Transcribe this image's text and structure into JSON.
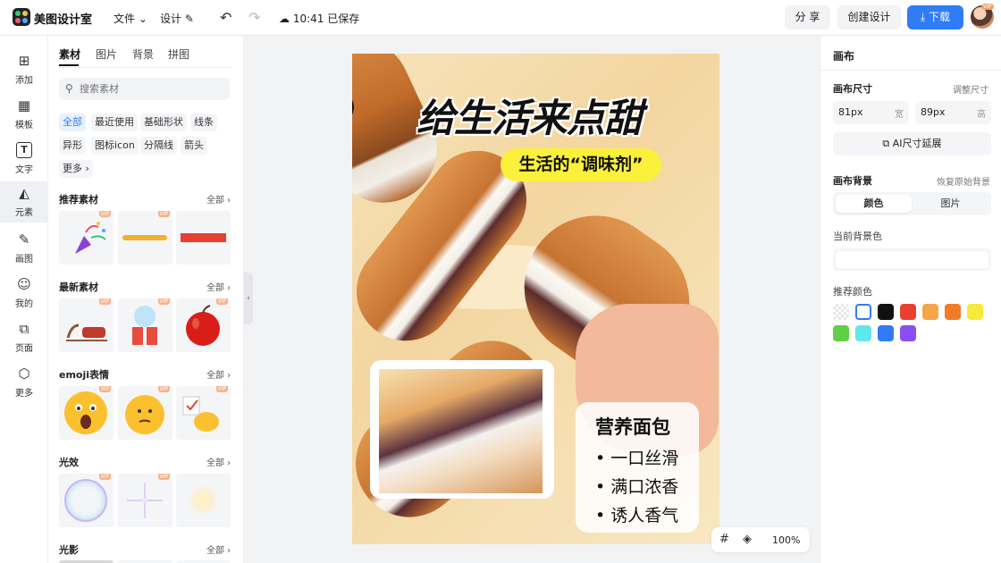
{
  "app": {
    "name": "美图设计室"
  },
  "toolbar": {
    "file_menu": "文件 ⌄",
    "design_menu": "设计 ✎",
    "save_status": "10:41 已保存",
    "share": "分 享",
    "create": "创建设计",
    "download": "下载"
  },
  "avatar_badge": "VIP",
  "rail": {
    "items": [
      {
        "label": "添加",
        "icon": "plus-square-icon"
      },
      {
        "label": "模板",
        "icon": "template-icon"
      },
      {
        "label": "文字",
        "icon": "text-icon"
      },
      {
        "label": "元素",
        "icon": "shapes-icon"
      },
      {
        "label": "画图",
        "icon": "edit-icon"
      },
      {
        "label": "我的",
        "icon": "user-icon"
      },
      {
        "label": "页面",
        "icon": "page-icon"
      },
      {
        "label": "更多",
        "icon": "cube-icon"
      }
    ]
  },
  "panel": {
    "tabs": [
      "素材",
      "图片",
      "背景",
      "拼图"
    ],
    "search_placeholder": "搜索素材",
    "chips": [
      "全部",
      "最近使用",
      "基础形状",
      "线条",
      "异形",
      "图标icon",
      "分隔线",
      "箭头",
      "更多 ›"
    ],
    "all_label": "全部 ›",
    "vip": "VIP",
    "sections": [
      "推荐素材",
      "最新素材",
      "emoji表情",
      "光效",
      "光影"
    ]
  },
  "poster": {
    "headline": "给生活来点甜",
    "subtitle": "生活的“调味剂”",
    "card_title": "营养面包",
    "points": [
      "• 一口丝滑",
      "• 满口浓香",
      "• 诱人香气"
    ]
  },
  "zoom": {
    "value": "100%"
  },
  "right": {
    "title": "画布",
    "size_label": "画布尺寸",
    "adjust_size": "调整尺寸",
    "width_value": "81px",
    "width_unit": "宽",
    "height_value": "89px",
    "height_unit": "高",
    "ai_extend": "AI尺寸延展",
    "bg_label": "画布背景",
    "restore_bg": "恢复原始背景",
    "seg_color": "颜色",
    "seg_image": "图片",
    "current_bg": "当前背景色",
    "recommended": "推荐颜色",
    "swatches": [
      "transparent",
      "#ffffff",
      "#111111",
      "#e8402e",
      "#f5a64a",
      "#f07c2a",
      "#f6ea3a",
      "#5fcf45",
      "#5ee8ec",
      "#2e7cf6",
      "#8a4ff0"
    ]
  }
}
